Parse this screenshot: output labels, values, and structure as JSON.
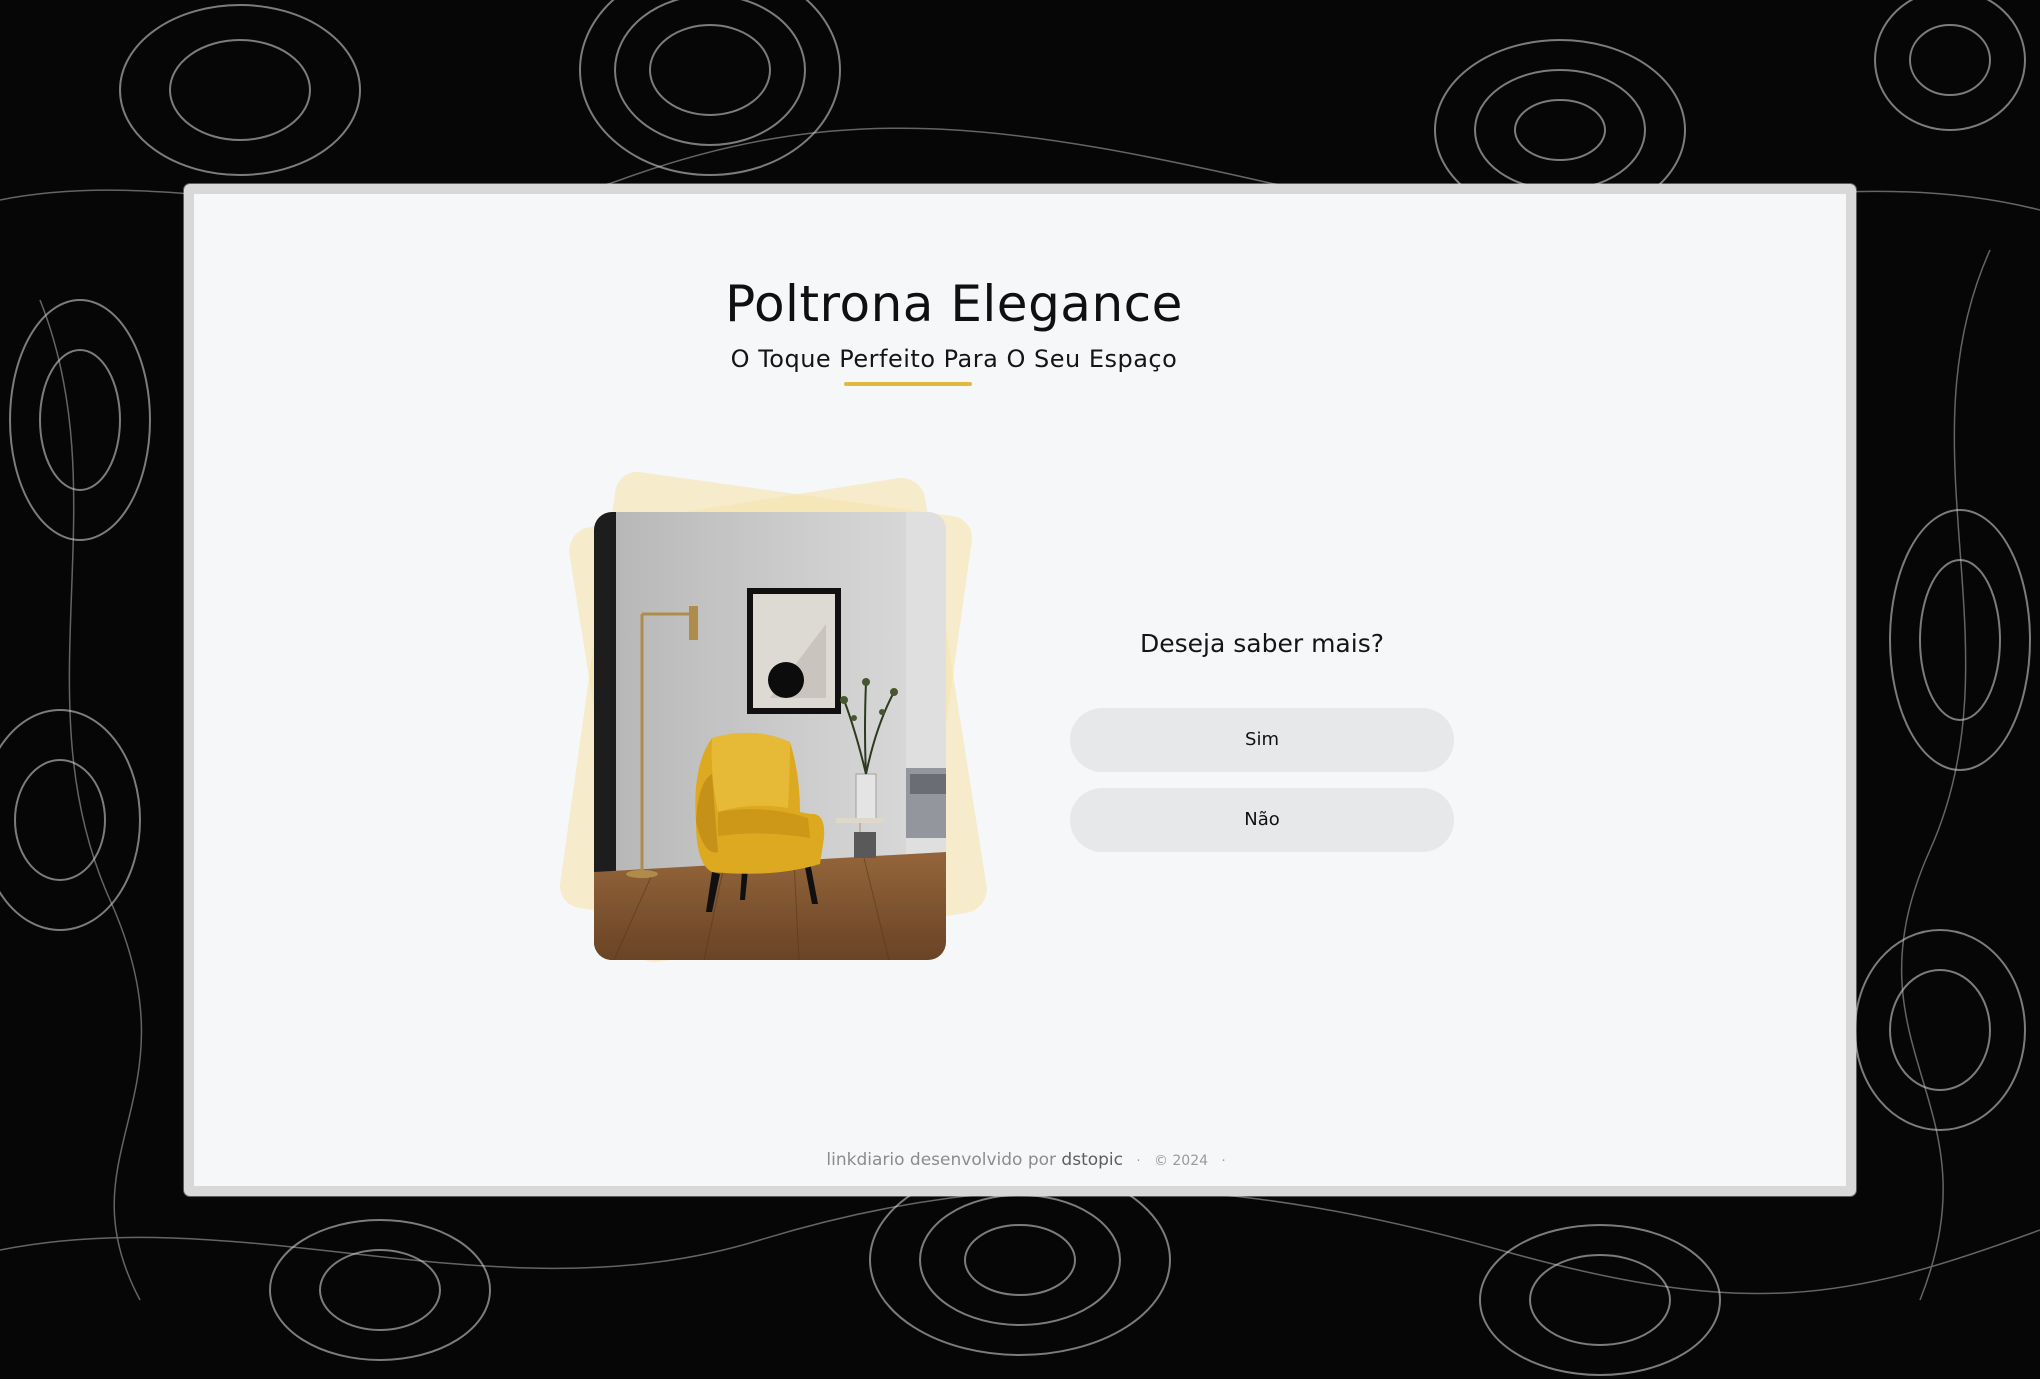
{
  "header": {
    "title": "Poltrona Elegance",
    "subtitle": "O Toque Perfeito Para O Seu Espaço"
  },
  "colors": {
    "accent": "#e2b93b",
    "panel_background": "#f5f7f9",
    "button_background": "#e7e8ea",
    "chair": "#e5b022"
  },
  "product_image": {
    "alt": "Poltrona amarela ao lado de luminária dourada e quadro"
  },
  "prompt": {
    "question": "Deseja saber mais?",
    "options": [
      {
        "label": "Sim"
      },
      {
        "label": "Não"
      }
    ]
  },
  "footer": {
    "text": "linkdiario desenvolvido por",
    "brand": "dstopic",
    "separator": "·",
    "copyright": "© 2024"
  }
}
